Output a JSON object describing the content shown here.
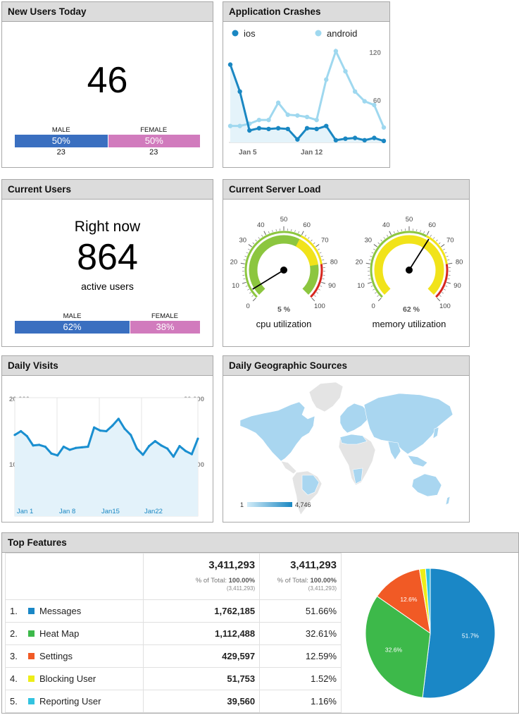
{
  "new_users": {
    "title": "New Users Today",
    "count": "46",
    "male_label": "MALE",
    "female_label": "FEMALE",
    "male_pct": "50%",
    "female_pct": "50%",
    "male_share": 0.5,
    "male_count": "23",
    "female_count": "23"
  },
  "crashes": {
    "title": "Application Crashes",
    "legend": [
      {
        "name": "ios",
        "color": "#1a87c2"
      },
      {
        "name": "android",
        "color": "#9fd8ef"
      }
    ],
    "y_ticks": [
      "120",
      "60"
    ],
    "x_ticks": [
      "Jan 5",
      "Jan 12"
    ],
    "chart_data": {
      "type": "line",
      "ylim": [
        0,
        130
      ],
      "series": [
        {
          "name": "ios",
          "values": [
            104,
            68,
            16,
            19,
            18,
            19,
            18,
            4,
            19,
            18,
            22,
            3,
            5,
            6,
            3,
            6,
            2
          ]
        },
        {
          "name": "android",
          "values": [
            22,
            22,
            25,
            30,
            30,
            53,
            37,
            36,
            34,
            30,
            84,
            122,
            95,
            68,
            55,
            50,
            20
          ]
        }
      ]
    }
  },
  "current_users": {
    "title": "Current Users",
    "right_now": "Right now",
    "count": "864",
    "active_label": "active users",
    "male_label": "MALE",
    "female_label": "FEMALE",
    "male_pct": "62%",
    "female_pct": "38%",
    "male_share": 0.62
  },
  "server_load": {
    "title": "Current Server Load",
    "gauges": [
      {
        "value": 5,
        "value_label": "5 %",
        "caption": "cpu utilization"
      },
      {
        "value": 62,
        "value_label": "62 %",
        "caption": "memory utilization"
      }
    ],
    "scale": [
      "0",
      "10",
      "20",
      "30",
      "40",
      "50",
      "60",
      "70",
      "80",
      "90",
      "100"
    ]
  },
  "daily_visits": {
    "title": "Daily Visits",
    "y_ticks": [
      "20,000",
      "10,000"
    ],
    "x_ticks": [
      "Jan 1",
      "Jan 8",
      "Jan15",
      "Jan22"
    ],
    "chart_data": {
      "type": "area",
      "ylim": [
        0,
        20000
      ],
      "values": [
        14000,
        14600,
        13800,
        12300,
        12400,
        12100,
        11000,
        10700,
        12100,
        11600,
        11900,
        12000,
        12100,
        15200,
        14700,
        14600,
        15500,
        16600,
        15000,
        14000,
        11800,
        10800,
        12200,
        13000,
        12300,
        11800,
        10500,
        12200,
        11400,
        10900,
        13400
      ]
    }
  },
  "geo": {
    "title": "Daily Geographic Sources",
    "legend_min": "1",
    "legend_max": "4,746"
  },
  "top_features": {
    "title": "Top Features",
    "total": "3,411,293",
    "pct_label": "% of Total:",
    "pct_value": "100.00%",
    "pct_sub": "(3,411,293)",
    "rows": [
      {
        "rank": "1.",
        "name": "Messages",
        "value": "1,762,185",
        "pct": "51.66%",
        "color": "#1a87c6"
      },
      {
        "rank": "2.",
        "name": "Heat Map",
        "value": "1,112,488",
        "pct": "32.61%",
        "color": "#3db94a"
      },
      {
        "rank": "3.",
        "name": "Settings",
        "value": "429,597",
        "pct": "12.59%",
        "color": "#f15a25"
      },
      {
        "rank": "4.",
        "name": "Blocking User",
        "value": "51,753",
        "pct": "1.52%",
        "color": "#eded18"
      },
      {
        "rank": "5.",
        "name": "Reporting User",
        "value": "39,560",
        "pct": "1.16%",
        "color": "#33c3e0"
      }
    ],
    "chart_data": {
      "type": "pie",
      "categories": [
        "Messages",
        "Heat Map",
        "Settings",
        "Blocking User",
        "Reporting User"
      ],
      "values": [
        51.66,
        32.61,
        12.59,
        1.52,
        1.16
      ],
      "slice_labels": [
        "51.7%",
        "32.6%",
        "12.6%",
        "",
        ""
      ]
    }
  }
}
